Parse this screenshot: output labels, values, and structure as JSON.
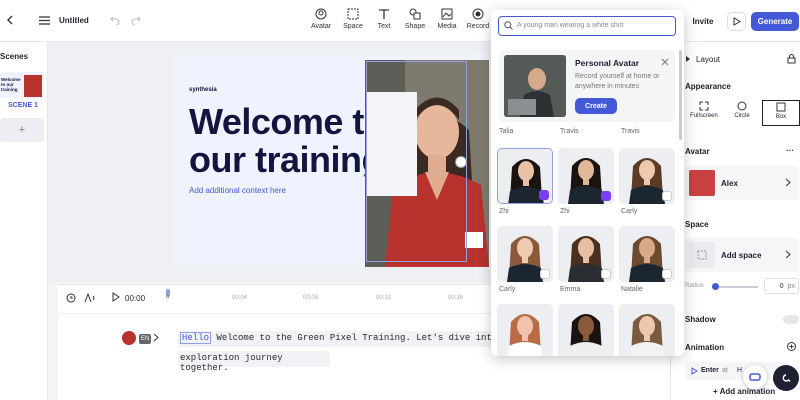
{
  "topbar": {
    "title": "Untitled",
    "tools": [
      {
        "label": "Avatar",
        "icon": "avatar-icon"
      },
      {
        "label": "Space",
        "icon": "space-icon"
      },
      {
        "label": "Text",
        "icon": "text-icon"
      },
      {
        "label": "Shape",
        "icon": "shape-icon"
      },
      {
        "label": "Media",
        "icon": "media-icon"
      },
      {
        "label": "Record",
        "icon": "record-icon"
      }
    ],
    "invite": "Invite",
    "generate": "Generate"
  },
  "scenes": {
    "header": "Scenes",
    "thumb_text": "Welcome to our training",
    "scene_label": "SCENE 1",
    "add": "+"
  },
  "slide": {
    "logo": "synthesia",
    "title_line1": "Welcome to",
    "title_line2": "our training",
    "subtitle": "Add additional context here"
  },
  "timeline": {
    "time": "00:00",
    "ticks": [
      "0",
      "00:04",
      "00:08",
      "00:12",
      "00:16"
    ],
    "lang": "EN",
    "script_highlight": "Hello",
    "script_line1": " Welcome to the Green Pixel Training. Let's dive into th",
    "script_line2": "exploration journey together."
  },
  "popup": {
    "search_placeholder": "A young man wearing a white shirt",
    "personal": {
      "title": "Personal Avatar",
      "desc": "Record yourself at home or anywhere in minutes",
      "create": "Create"
    },
    "top_names": [
      "Talia",
      "Travis",
      "Travis"
    ],
    "avatars": [
      {
        "name": "Zhi",
        "badge": true
      },
      {
        "name": "Zhi",
        "badge": true
      },
      {
        "name": "Carly",
        "badge": false
      },
      {
        "name": "Carly",
        "badge": false
      },
      {
        "name": "Emma",
        "badge": false
      },
      {
        "name": "Natalie",
        "badge": false
      },
      {
        "name": "",
        "badge": false
      },
      {
        "name": "",
        "badge": false
      },
      {
        "name": "",
        "badge": false
      }
    ]
  },
  "panel": {
    "layout": "Layout",
    "appearance": "Appearance",
    "modes": [
      "Fullscreen",
      "Circle",
      "Box"
    ],
    "avatar_header": "Avatar",
    "avatar_name": "Alex",
    "more": "···",
    "space_header": "Space",
    "add_space": "Add space",
    "radius_label": "Radius",
    "radius_value": "0",
    "radius_unit": "px",
    "shadow": "Shadow",
    "animation": "Animation",
    "enter_label": "Enter",
    "enter_at": "at",
    "enter_value": "H",
    "add_animation": "+ Add animation"
  },
  "colors": {
    "accent": "#4459d6",
    "purple": "#7a3ff2",
    "title": "#13153f"
  }
}
